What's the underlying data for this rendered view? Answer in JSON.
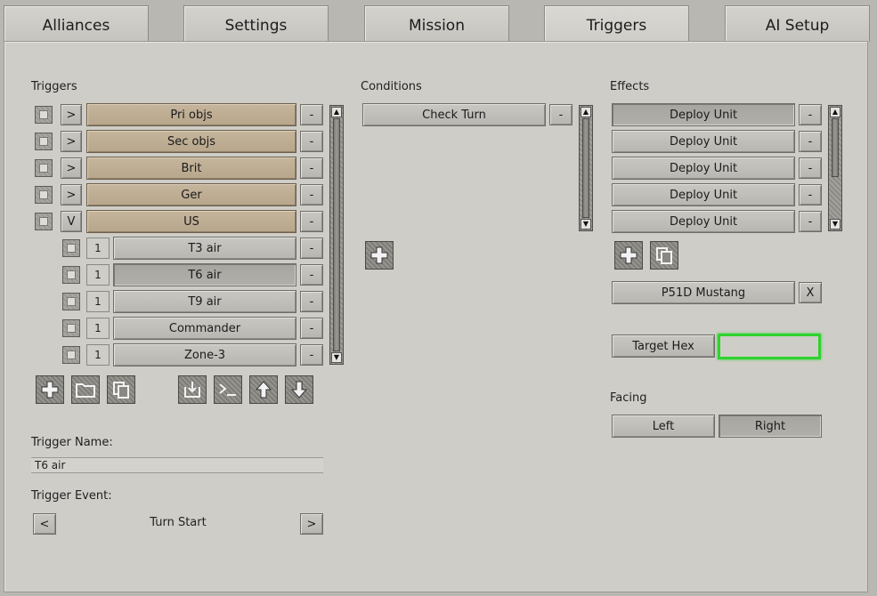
{
  "tabs": [
    {
      "label": "Alliances"
    },
    {
      "label": "Settings"
    },
    {
      "label": "Mission"
    },
    {
      "label": "Triggers"
    },
    {
      "label": "AI Setup"
    }
  ],
  "triggers": {
    "header": "Triggers",
    "groups": [
      {
        "toggle": ">",
        "label": "Pri objs"
      },
      {
        "toggle": ">",
        "label": "Sec objs"
      },
      {
        "toggle": ">",
        "label": "Brit"
      },
      {
        "toggle": ">",
        "label": "Ger"
      },
      {
        "toggle": "V",
        "label": "US"
      }
    ],
    "items": [
      {
        "count": "1",
        "label": "T3 air"
      },
      {
        "count": "1",
        "label": "T6 air"
      },
      {
        "count": "1",
        "label": "T9 air"
      },
      {
        "count": "1",
        "label": "Commander"
      },
      {
        "count": "1",
        "label": "Zone-3"
      }
    ],
    "remove_label": "-",
    "toolbar_icons": [
      "add-icon",
      "folder-icon",
      "copy-icon",
      "import-icon",
      "console-icon",
      "arrow-up-icon",
      "arrow-down-icon"
    ]
  },
  "trigger_name": {
    "label": "Trigger Name:",
    "value": "T6 air"
  },
  "trigger_event": {
    "label": "Trigger Event:",
    "prev": "<",
    "value": "Turn Start",
    "next": ">"
  },
  "conditions": {
    "header": "Conditions",
    "items": [
      {
        "label": "Check Turn"
      }
    ],
    "remove_label": "-"
  },
  "effects": {
    "header": "Effects",
    "items": [
      {
        "label": "Deploy Unit"
      },
      {
        "label": "Deploy Unit"
      },
      {
        "label": "Deploy Unit"
      },
      {
        "label": "Deploy Unit"
      },
      {
        "label": "Deploy Unit"
      }
    ],
    "remove_label": "-",
    "unit": {
      "label": "P51D Mustang",
      "clear": "X"
    },
    "target_hex": {
      "label": "Target Hex",
      "value": ""
    },
    "facing": {
      "label": "Facing",
      "left": "Left",
      "right": "Right"
    }
  },
  "colors": {
    "highlight": "#2fd22f",
    "tan": "#bfae93"
  }
}
